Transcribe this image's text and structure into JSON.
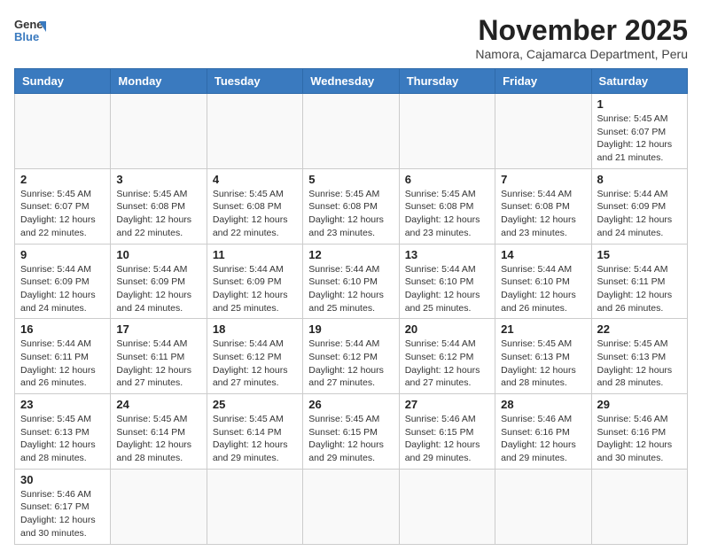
{
  "logo": {
    "text_general": "General",
    "text_blue": "Blue"
  },
  "title": "November 2025",
  "subtitle": "Namora, Cajamarca Department, Peru",
  "days_of_week": [
    "Sunday",
    "Monday",
    "Tuesday",
    "Wednesday",
    "Thursday",
    "Friday",
    "Saturday"
  ],
  "weeks": [
    [
      {
        "day": "",
        "info": ""
      },
      {
        "day": "",
        "info": ""
      },
      {
        "day": "",
        "info": ""
      },
      {
        "day": "",
        "info": ""
      },
      {
        "day": "",
        "info": ""
      },
      {
        "day": "",
        "info": ""
      },
      {
        "day": "1",
        "info": "Sunrise: 5:45 AM\nSunset: 6:07 PM\nDaylight: 12 hours and 21 minutes."
      }
    ],
    [
      {
        "day": "2",
        "info": "Sunrise: 5:45 AM\nSunset: 6:07 PM\nDaylight: 12 hours and 22 minutes."
      },
      {
        "day": "3",
        "info": "Sunrise: 5:45 AM\nSunset: 6:08 PM\nDaylight: 12 hours and 22 minutes."
      },
      {
        "day": "4",
        "info": "Sunrise: 5:45 AM\nSunset: 6:08 PM\nDaylight: 12 hours and 22 minutes."
      },
      {
        "day": "5",
        "info": "Sunrise: 5:45 AM\nSunset: 6:08 PM\nDaylight: 12 hours and 23 minutes."
      },
      {
        "day": "6",
        "info": "Sunrise: 5:45 AM\nSunset: 6:08 PM\nDaylight: 12 hours and 23 minutes."
      },
      {
        "day": "7",
        "info": "Sunrise: 5:44 AM\nSunset: 6:08 PM\nDaylight: 12 hours and 23 minutes."
      },
      {
        "day": "8",
        "info": "Sunrise: 5:44 AM\nSunset: 6:09 PM\nDaylight: 12 hours and 24 minutes."
      }
    ],
    [
      {
        "day": "9",
        "info": "Sunrise: 5:44 AM\nSunset: 6:09 PM\nDaylight: 12 hours and 24 minutes."
      },
      {
        "day": "10",
        "info": "Sunrise: 5:44 AM\nSunset: 6:09 PM\nDaylight: 12 hours and 24 minutes."
      },
      {
        "day": "11",
        "info": "Sunrise: 5:44 AM\nSunset: 6:09 PM\nDaylight: 12 hours and 25 minutes."
      },
      {
        "day": "12",
        "info": "Sunrise: 5:44 AM\nSunset: 6:10 PM\nDaylight: 12 hours and 25 minutes."
      },
      {
        "day": "13",
        "info": "Sunrise: 5:44 AM\nSunset: 6:10 PM\nDaylight: 12 hours and 25 minutes."
      },
      {
        "day": "14",
        "info": "Sunrise: 5:44 AM\nSunset: 6:10 PM\nDaylight: 12 hours and 26 minutes."
      },
      {
        "day": "15",
        "info": "Sunrise: 5:44 AM\nSunset: 6:11 PM\nDaylight: 12 hours and 26 minutes."
      }
    ],
    [
      {
        "day": "16",
        "info": "Sunrise: 5:44 AM\nSunset: 6:11 PM\nDaylight: 12 hours and 26 minutes."
      },
      {
        "day": "17",
        "info": "Sunrise: 5:44 AM\nSunset: 6:11 PM\nDaylight: 12 hours and 27 minutes."
      },
      {
        "day": "18",
        "info": "Sunrise: 5:44 AM\nSunset: 6:12 PM\nDaylight: 12 hours and 27 minutes."
      },
      {
        "day": "19",
        "info": "Sunrise: 5:44 AM\nSunset: 6:12 PM\nDaylight: 12 hours and 27 minutes."
      },
      {
        "day": "20",
        "info": "Sunrise: 5:44 AM\nSunset: 6:12 PM\nDaylight: 12 hours and 27 minutes."
      },
      {
        "day": "21",
        "info": "Sunrise: 5:45 AM\nSunset: 6:13 PM\nDaylight: 12 hours and 28 minutes."
      },
      {
        "day": "22",
        "info": "Sunrise: 5:45 AM\nSunset: 6:13 PM\nDaylight: 12 hours and 28 minutes."
      }
    ],
    [
      {
        "day": "23",
        "info": "Sunrise: 5:45 AM\nSunset: 6:13 PM\nDaylight: 12 hours and 28 minutes."
      },
      {
        "day": "24",
        "info": "Sunrise: 5:45 AM\nSunset: 6:14 PM\nDaylight: 12 hours and 28 minutes."
      },
      {
        "day": "25",
        "info": "Sunrise: 5:45 AM\nSunset: 6:14 PM\nDaylight: 12 hours and 29 minutes."
      },
      {
        "day": "26",
        "info": "Sunrise: 5:45 AM\nSunset: 6:15 PM\nDaylight: 12 hours and 29 minutes."
      },
      {
        "day": "27",
        "info": "Sunrise: 5:46 AM\nSunset: 6:15 PM\nDaylight: 12 hours and 29 minutes."
      },
      {
        "day": "28",
        "info": "Sunrise: 5:46 AM\nSunset: 6:16 PM\nDaylight: 12 hours and 29 minutes."
      },
      {
        "day": "29",
        "info": "Sunrise: 5:46 AM\nSunset: 6:16 PM\nDaylight: 12 hours and 30 minutes."
      }
    ],
    [
      {
        "day": "30",
        "info": "Sunrise: 5:46 AM\nSunset: 6:17 PM\nDaylight: 12 hours and 30 minutes."
      },
      {
        "day": "",
        "info": ""
      },
      {
        "day": "",
        "info": ""
      },
      {
        "day": "",
        "info": ""
      },
      {
        "day": "",
        "info": ""
      },
      {
        "day": "",
        "info": ""
      },
      {
        "day": "",
        "info": ""
      }
    ]
  ]
}
